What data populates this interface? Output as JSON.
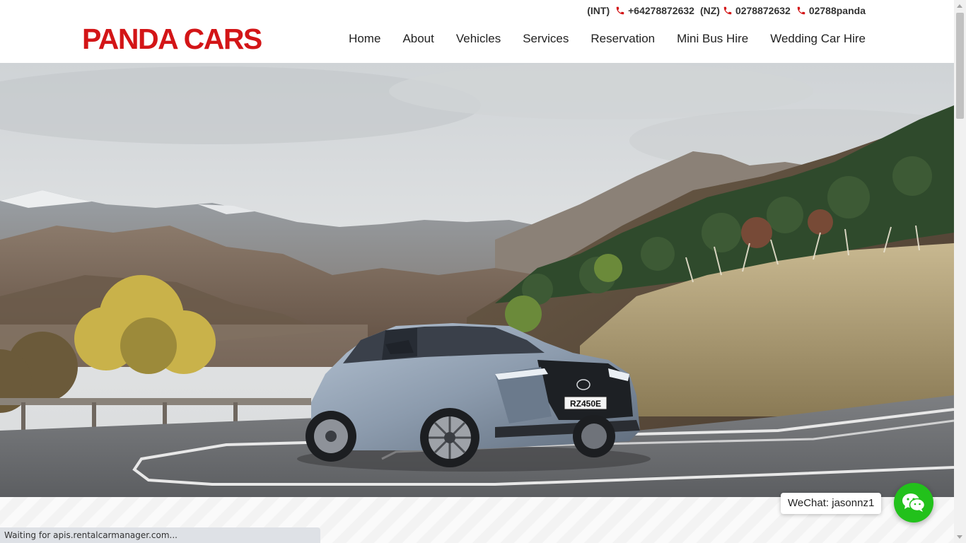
{
  "brand": {
    "logo_text": "PANDA CARS",
    "color": "#d31517"
  },
  "contact": {
    "int_label": "(INT)",
    "int_number": "+64278872632",
    "nz_label": "(NZ)",
    "nz_number": "0278872632",
    "alt_number": "02788panda",
    "icon": "phone-icon"
  },
  "nav": {
    "items": [
      "Home",
      "About",
      "Vehicles",
      "Services",
      "Reservation",
      "Mini Bus Hire",
      "Wedding Car Hire"
    ]
  },
  "hero": {
    "plate_text": "RZ450E"
  },
  "wechat": {
    "label": "WeChat: jasonnz1",
    "color": "#22c11b",
    "icon": "wechat-icon"
  },
  "status": {
    "text": "Waiting for apis.rentalcarmanager.com..."
  }
}
